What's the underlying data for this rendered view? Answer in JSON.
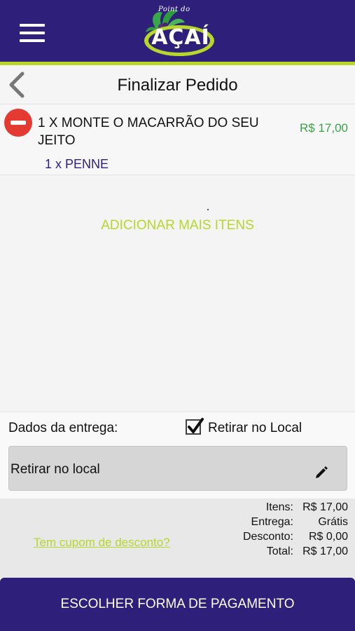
{
  "header": {
    "menu_icon": "hamburger-menu-icon",
    "logo": {
      "tagline": "Point do",
      "word": "AÇAÍ"
    },
    "colors": {
      "primary": "#2e1f7a",
      "accent": "#b6d62b"
    }
  },
  "titlebar": {
    "back_icon": "chevron-left-icon",
    "title": "Finalizar Pedido"
  },
  "cart": {
    "items": [
      {
        "name": "1 X MONTE O MACARRÃO DO SEU JEITO",
        "price": "R$ 17,00",
        "options": [
          "1 x PENNE"
        ]
      }
    ],
    "add_more_label": "ADICIONAR MAIS ITENS"
  },
  "delivery": {
    "label": "Dados da entrega:",
    "pickup_checkbox_label": "Retirar no Local",
    "pickup_checked": true,
    "address_value": "Retirar no local",
    "edit_icon": "pencil-icon"
  },
  "totals": {
    "coupon_link": "Tem cupom de desconto?",
    "lines": [
      {
        "label": "Itens:",
        "value": "R$ 17,00"
      },
      {
        "label": "Entrega:",
        "value": "Grátis"
      },
      {
        "label": "Desconto:",
        "value": "R$ 0,00"
      },
      {
        "label": "Total:",
        "value": "R$ 17,00"
      }
    ]
  },
  "footer": {
    "pay_button": "ESCOLHER FORMA DE PAGAMENTO"
  }
}
